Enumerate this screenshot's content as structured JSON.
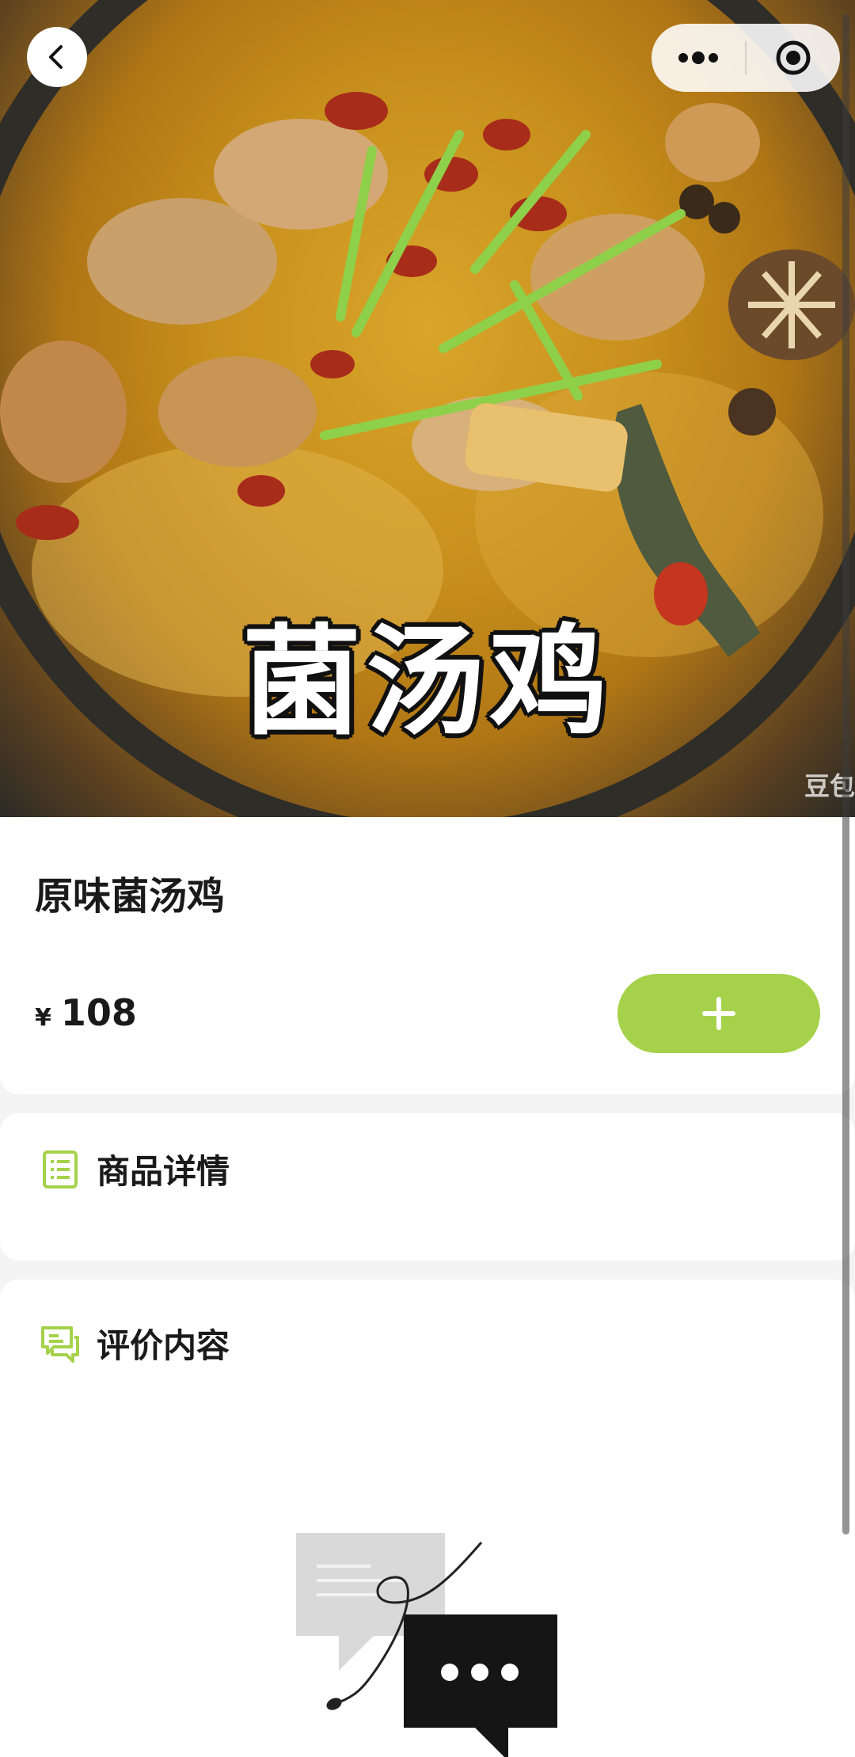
{
  "hero": {
    "overlay_title": "菌汤鸡",
    "watermark": "豆包"
  },
  "nav": {
    "back_icon": "chevron-left-icon",
    "more_icon": "more-dots-icon",
    "close_icon": "target-circle-icon"
  },
  "product": {
    "name": "原味菌汤鸡",
    "currency_symbol": "¥",
    "price": "108",
    "add_icon": "plus-icon"
  },
  "sections": {
    "detail": {
      "title": "商品详情",
      "icon": "list-document-icon"
    },
    "review": {
      "title": "评价内容",
      "icon": "chat-bubbles-icon"
    }
  },
  "colors": {
    "accent": "#a5d24a",
    "text": "#1a1a1a",
    "background": "#f4f4f4",
    "card": "#ffffff"
  }
}
